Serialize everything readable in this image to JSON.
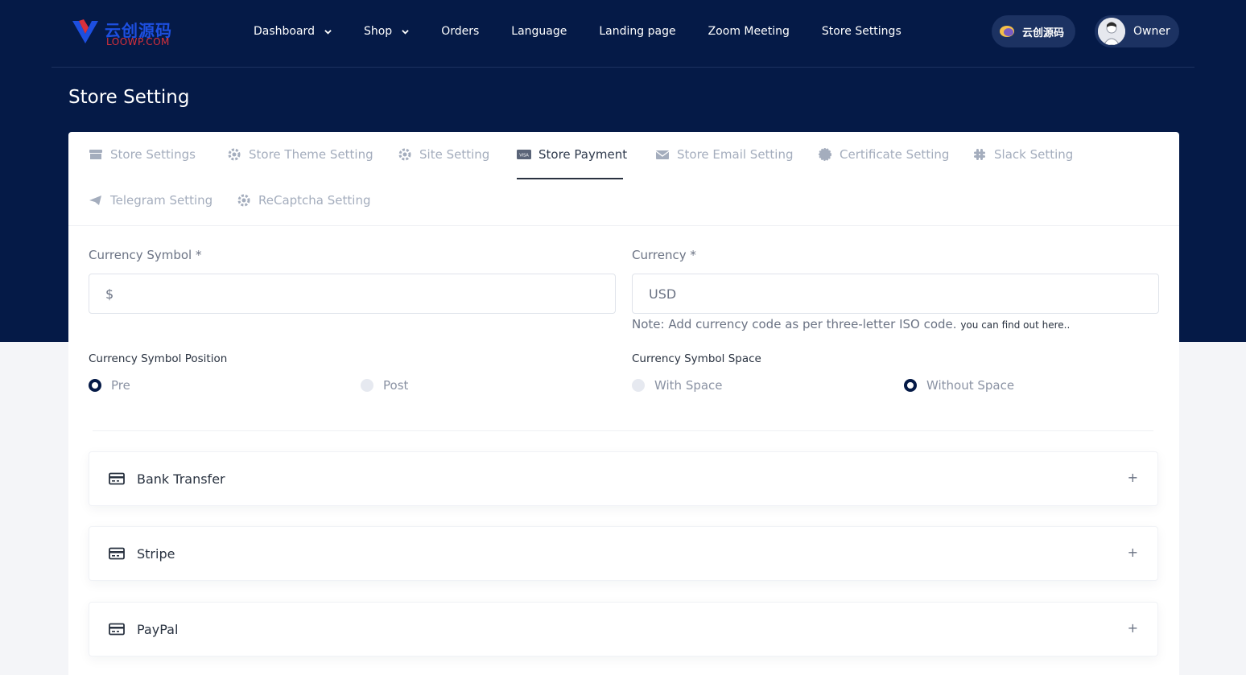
{
  "brand": {
    "name_cn": "云创源码",
    "name_en": "LOOWP.COM"
  },
  "nav": {
    "items": [
      {
        "label": "Dashboard",
        "dropdown": true
      },
      {
        "label": "Shop",
        "dropdown": true
      },
      {
        "label": "Orders",
        "dropdown": false
      },
      {
        "label": "Language",
        "dropdown": false
      },
      {
        "label": "Landing page",
        "dropdown": false
      },
      {
        "label": "Zoom Meeting",
        "dropdown": false
      },
      {
        "label": "Store Settings",
        "dropdown": false
      }
    ],
    "language_label": "云创源码",
    "user_label": "Owner"
  },
  "page": {
    "title": "Store Setting"
  },
  "tabs": [
    {
      "label": "Store Settings",
      "icon": "store-icon",
      "active": false
    },
    {
      "label": "Store Theme Setting",
      "icon": "gear-icon",
      "active": false
    },
    {
      "label": "Site Setting",
      "icon": "gear-icon",
      "active": false
    },
    {
      "label": "Store Payment",
      "icon": "visa-card-icon",
      "active": true
    },
    {
      "label": "Store Email Setting",
      "icon": "envelope-icon",
      "active": false
    },
    {
      "label": "Certificate Setting",
      "icon": "badge-icon",
      "active": false
    },
    {
      "label": "Slack Setting",
      "icon": "slack-icon",
      "active": false
    },
    {
      "label": "Telegram Setting",
      "icon": "telegram-icon",
      "active": false
    },
    {
      "label": "ReCaptcha Setting",
      "icon": "gear-icon",
      "active": false
    }
  ],
  "form": {
    "currency_symbol": {
      "label": "Currency Symbol *",
      "value": "$"
    },
    "currency": {
      "label": "Currency *",
      "value": "USD"
    },
    "note": {
      "text": "Note: Add currency code as per three-letter ISO code.",
      "link": "you can find out here.."
    },
    "symbol_position": {
      "label": "Currency Symbol Position",
      "options": [
        {
          "label": "Pre",
          "selected": true
        },
        {
          "label": "Post",
          "selected": false
        }
      ]
    },
    "symbol_space": {
      "label": "Currency Symbol Space",
      "options": [
        {
          "label": "With Space",
          "selected": false
        },
        {
          "label": "Without Space",
          "selected": true
        }
      ]
    }
  },
  "payments": [
    {
      "title": "Bank Transfer",
      "icon": "credit-card-icon",
      "toggle": "+"
    },
    {
      "title": "Stripe",
      "icon": "credit-card-icon",
      "toggle": "+"
    },
    {
      "title": "PayPal",
      "icon": "credit-card-icon",
      "toggle": "+"
    }
  ],
  "colors": {
    "header_bg": "#051a47",
    "pill_bg": "#1c3262",
    "page_bg": "#f4f5f8",
    "text_dark": "#293240",
    "text_muted": "#a4adbd",
    "logo_blue": "#1d4fe0",
    "logo_red": "#d8303b"
  }
}
